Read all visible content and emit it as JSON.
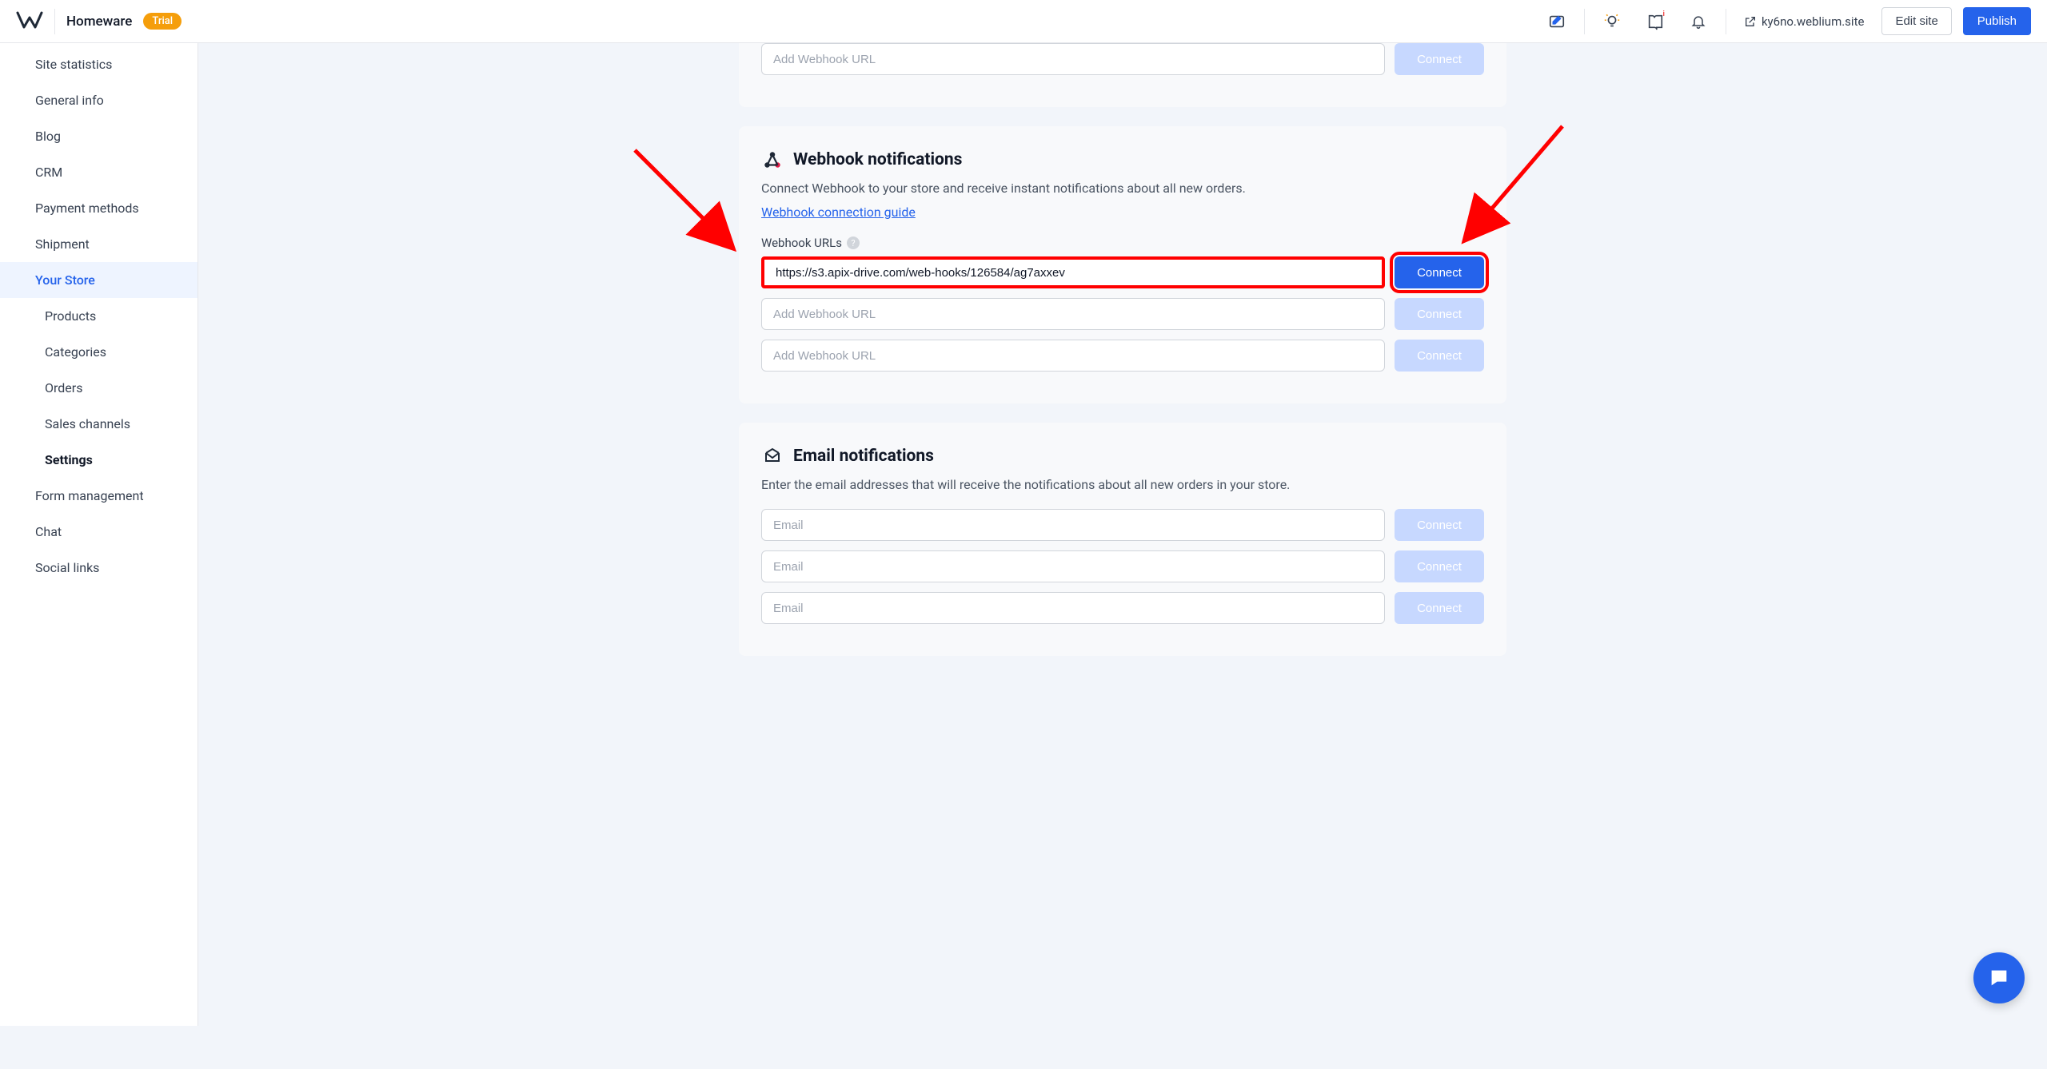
{
  "header": {
    "site_name": "Homeware",
    "trial_label": "Trial",
    "site_url": "ky6no.weblium.site",
    "edit_label": "Edit site",
    "publish_label": "Publish"
  },
  "sidebar": {
    "items": [
      {
        "label": "Site statistics",
        "level": 0
      },
      {
        "label": "General info",
        "level": 0
      },
      {
        "label": "Blog",
        "level": 0
      },
      {
        "label": "CRM",
        "level": 0
      },
      {
        "label": "Payment methods",
        "level": 0
      },
      {
        "label": "Shipment",
        "level": 0
      },
      {
        "label": "Your Store",
        "level": 0,
        "active": true
      },
      {
        "label": "Products",
        "level": 1
      },
      {
        "label": "Categories",
        "level": 1
      },
      {
        "label": "Orders",
        "level": 1
      },
      {
        "label": "Sales channels",
        "level": 1
      },
      {
        "label": "Settings",
        "level": 1,
        "bold": true
      },
      {
        "label": "Form management",
        "level": 0
      },
      {
        "label": "Chat",
        "level": 0
      },
      {
        "label": "Social links",
        "level": 0
      }
    ]
  },
  "prev_section": {
    "placeholder": "Add Webhook URL",
    "connect_label": "Connect"
  },
  "webhook": {
    "title": "Webhook notifications",
    "desc": "Connect Webhook to your store and receive instant notifications about all new orders.",
    "guide_link": "Webhook connection guide",
    "urls_label": "Webhook URLs",
    "rows": [
      {
        "value": "https://s3.apix-drive.com/web-hooks/126584/ag7axxev",
        "placeholder": "",
        "active": true
      },
      {
        "value": "",
        "placeholder": "Add Webhook URL",
        "active": false
      },
      {
        "value": "",
        "placeholder": "Add Webhook URL",
        "active": false
      }
    ],
    "connect_label": "Connect"
  },
  "email": {
    "title": "Email notifications",
    "desc": "Enter the email addresses that will receive the notifications about all new orders in your store.",
    "rows": [
      {
        "value": "",
        "placeholder": "Email"
      },
      {
        "value": "",
        "placeholder": "Email"
      },
      {
        "value": "",
        "placeholder": "Email"
      }
    ],
    "connect_label": "Connect"
  }
}
